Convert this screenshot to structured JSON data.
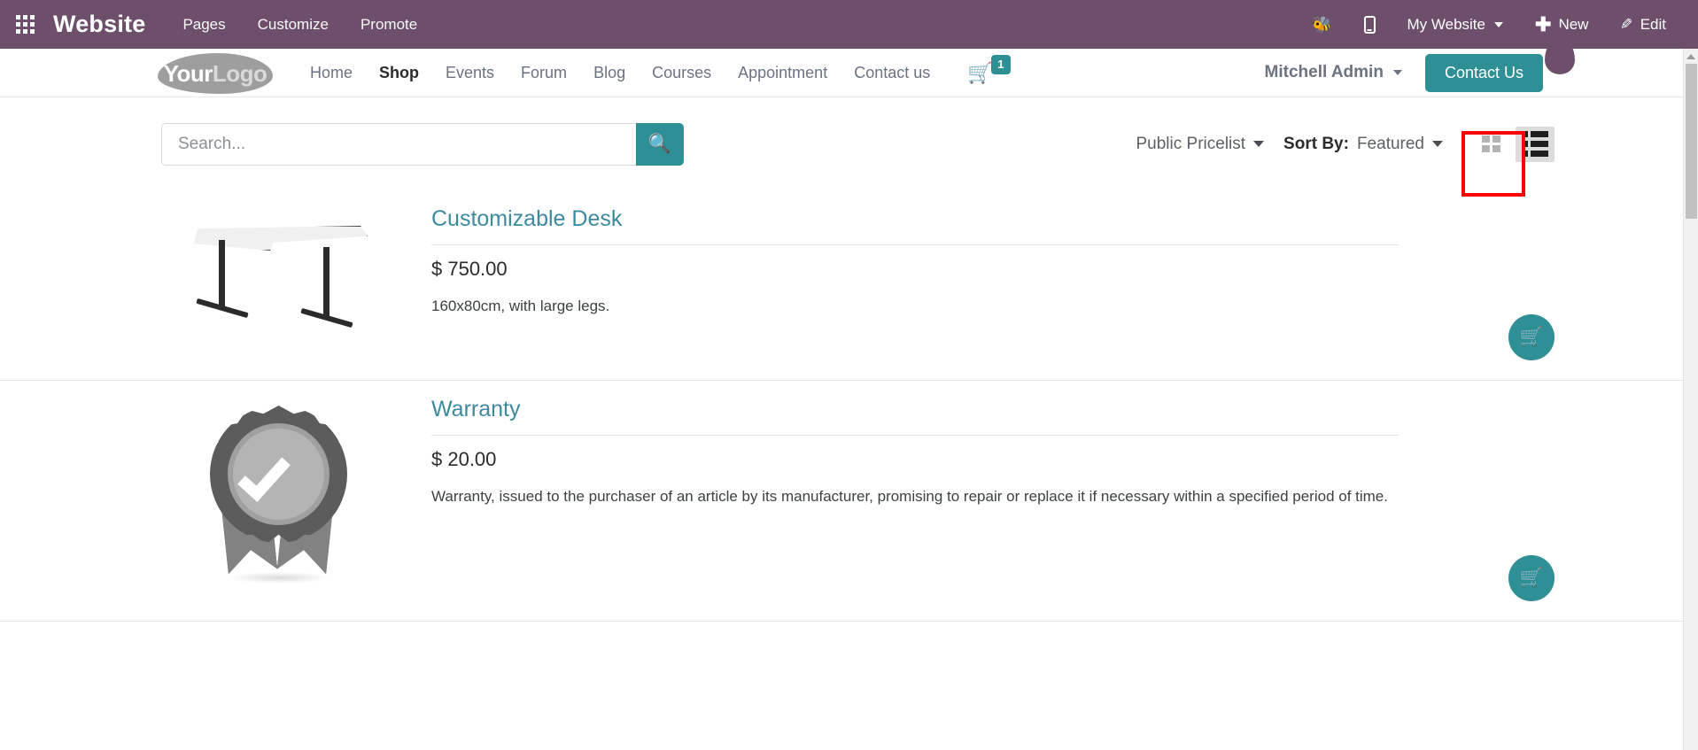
{
  "backend_topbar": {
    "apps_icon": "apps-grid-icon",
    "app_title": "Website",
    "menu": [
      {
        "label": "Pages"
      },
      {
        "label": "Customize"
      },
      {
        "label": "Promote"
      }
    ],
    "right": {
      "debug_icon": "bug-icon",
      "mobile_preview_icon": "mobile-icon",
      "website_selector": "My Website",
      "new_label": "New",
      "new_icon": "plus-icon",
      "edit_label": "Edit",
      "edit_icon": "pencil-icon"
    }
  },
  "site_header": {
    "logo": {
      "part1": "Your",
      "part2": "Logo"
    },
    "nav": [
      {
        "label": "Home",
        "active": false
      },
      {
        "label": "Shop",
        "active": true
      },
      {
        "label": "Events",
        "active": false
      },
      {
        "label": "Forum",
        "active": false
      },
      {
        "label": "Blog",
        "active": false
      },
      {
        "label": "Courses",
        "active": false
      },
      {
        "label": "Appointment",
        "active": false
      },
      {
        "label": "Contact us",
        "active": false
      }
    ],
    "cart": {
      "icon": "shopping-cart-icon",
      "count": "1"
    },
    "user": "Mitchell Admin",
    "cta_button": "Contact Us"
  },
  "shop_toolbar": {
    "search": {
      "value": "",
      "placeholder": "Search...",
      "button_icon": "search-icon"
    },
    "pricelist": "Public Pricelist",
    "sort_by_label": "Sort By:",
    "sort_by_value": "Featured",
    "view_grid_icon": "grid-view-icon",
    "view_list_icon": "list-view-icon",
    "active_view": "list"
  },
  "products": [
    {
      "name": "Customizable Desk",
      "price": "$ 750.00",
      "description": "160x80cm, with large legs.",
      "image": "desk-image",
      "add_to_cart_icon": "shopping-cart-icon"
    },
    {
      "name": "Warranty",
      "price": "$ 20.00",
      "description": "Warranty, issued to the purchaser of an article by its manufacturer, promising to repair or replace it if necessary within a specified period of time.",
      "image": "warranty-badge-image",
      "add_to_cart_icon": "shopping-cart-icon"
    }
  ],
  "colors": {
    "topbar_purple": "#6d4f6b",
    "accent_teal": "#2e9095",
    "link_teal": "#3b8a9e",
    "highlight_red": "#ff0000"
  }
}
